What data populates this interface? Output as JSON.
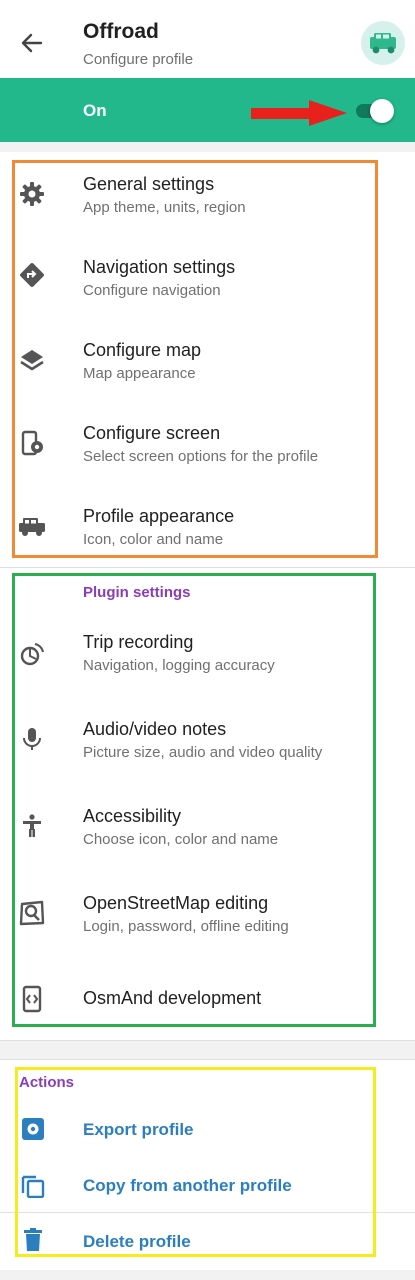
{
  "header": {
    "title": "Offroad",
    "subtitle": "Configure profile",
    "back_icon": "arrow-back-icon",
    "profile_icon": "offroad-car-icon"
  },
  "toggle": {
    "label": "On",
    "state": "on",
    "accent_color": "#22b88b"
  },
  "general": [
    {
      "icon": "gear-icon",
      "title": "General settings",
      "subtitle": "App theme, units, region"
    },
    {
      "icon": "navigation-diamond-icon",
      "title": "Navigation settings",
      "subtitle": "Configure navigation"
    },
    {
      "icon": "layers-icon",
      "title": "Configure map",
      "subtitle": "Map appearance"
    },
    {
      "icon": "screen-settings-icon",
      "title": "Configure screen",
      "subtitle": "Select screen options for the profile"
    },
    {
      "icon": "car-icon",
      "title": "Profile appearance",
      "subtitle": "Icon, color and name"
    }
  ],
  "plugins": {
    "section_title": "Plugin settings",
    "items": [
      {
        "icon": "trip-recording-icon",
        "title": "Trip recording",
        "subtitle": "Navigation, logging accuracy"
      },
      {
        "icon": "microphone-icon",
        "title": "Audio/video notes",
        "subtitle": "Picture size, audio and video quality"
      },
      {
        "icon": "accessibility-icon",
        "title": "Accessibility",
        "subtitle": "Choose icon, color and name"
      },
      {
        "icon": "osm-editing-icon",
        "title": "OpenStreetMap editing",
        "subtitle": "Login, password, offline editing"
      },
      {
        "icon": "development-icon",
        "title": "OsmAnd development",
        "subtitle": ""
      }
    ]
  },
  "actions": {
    "section_title": "Actions",
    "items": [
      {
        "icon": "export-icon",
        "label": "Export profile"
      },
      {
        "icon": "copy-icon",
        "label": "Copy from another profile"
      },
      {
        "icon": "trash-icon",
        "label": "Delete profile"
      }
    ]
  },
  "colors": {
    "section_title": "#8a3db8",
    "action_text": "#2b7fbf",
    "icon_gray": "#555555",
    "annotation_orange": "#f08a34",
    "annotation_green": "#2aae4f",
    "annotation_yellow": "#f5ec1b",
    "annotation_arrow": "#e8211d"
  }
}
